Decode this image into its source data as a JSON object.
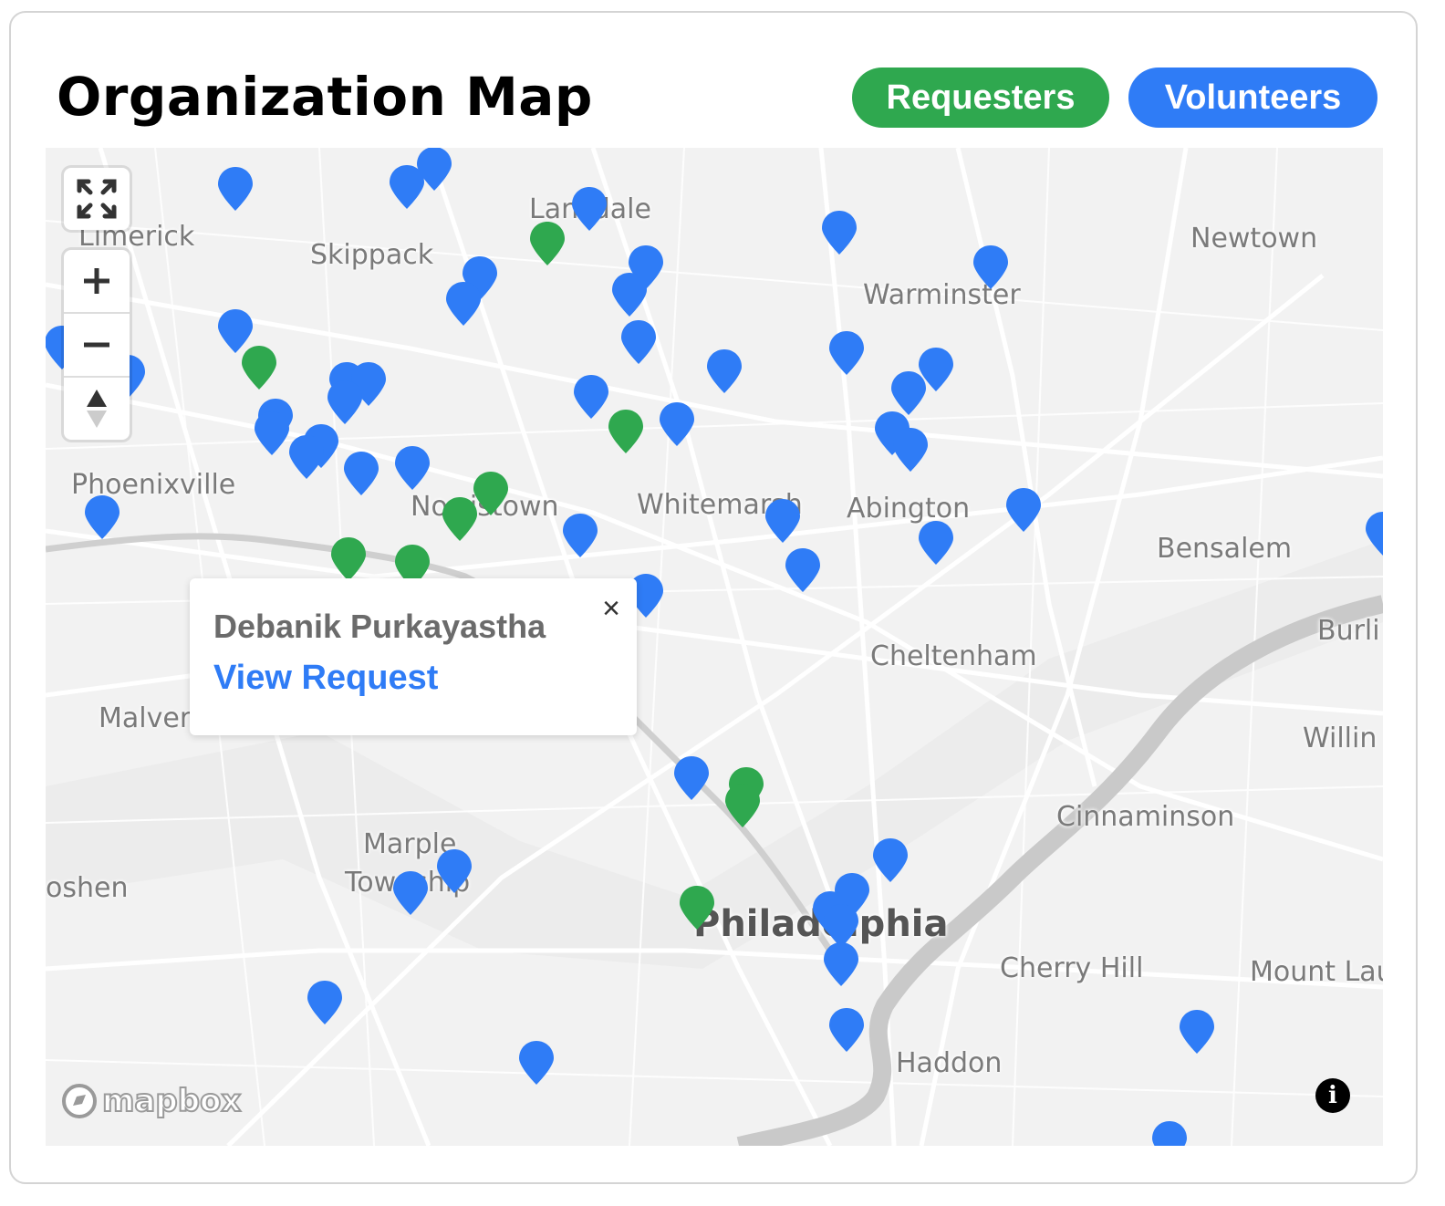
{
  "header": {
    "title": "Organization Map",
    "requesters_label": "Requesters",
    "volunteers_label": "Volunteers"
  },
  "colors": {
    "requester": "#2fa84f",
    "volunteer": "#2f7cf6"
  },
  "map": {
    "places": [
      "Limerick",
      "Skippack",
      "Lansdale",
      "Newtown",
      "Warminster",
      "Phoenixville",
      "Norristown",
      "Whitemarsh",
      "Abington",
      "Bensalem",
      "Cheltenham",
      "Burlington",
      "Malvern",
      "Willingboro",
      "Cinnaminson",
      "Marple Township",
      "Goshen",
      "Philadelphia",
      "Cherry Hill",
      "Mount Laurel",
      "Haddon"
    ],
    "place_labels": {
      "limerick": "Limerick",
      "skippack": "Skippack",
      "lansdale": "Lansdale",
      "newtown": "Newtown",
      "warminster": "Warminster",
      "phoenixville": "Phoenixville",
      "norristown": "Norristown",
      "whitemarsh": "Whitemarsh",
      "abington": "Abington",
      "bensalem": "Bensalem",
      "cheltenham": "Cheltenham",
      "burlington": "Burli",
      "malvern": "Malver",
      "willingboro": "Willin",
      "cinnaminson": "Cinnaminson",
      "marple": "Marple",
      "township": "Township",
      "goshen": "oshen",
      "philadelphia": "Philadelphia",
      "cherry_hill": "Cherry Hill",
      "mount_laurel": "Mount Lau",
      "haddon": "Haddon"
    }
  },
  "popup": {
    "name": "Debanik Purkayastha",
    "link": "View Request",
    "close": "×"
  },
  "attribution": {
    "logo": "mapbox",
    "info": "i"
  }
}
